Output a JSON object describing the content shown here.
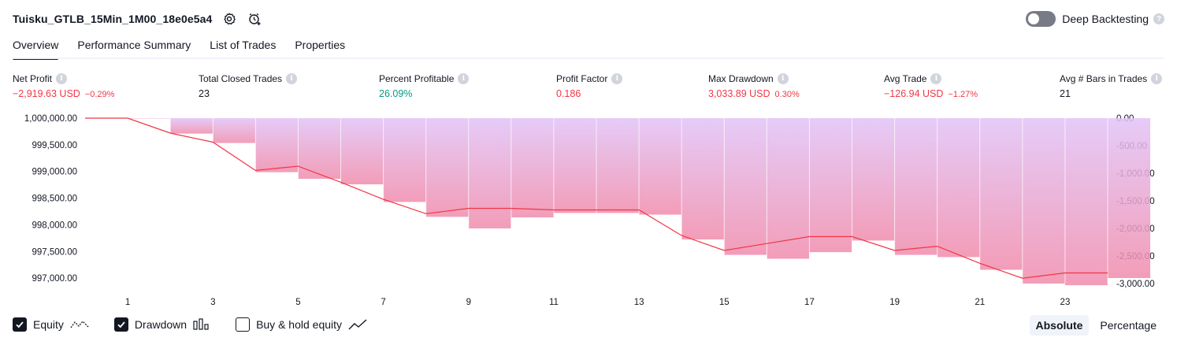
{
  "strategy": {
    "title": "Tuisku_GTLB_15Min_1M00_18e0e5a4"
  },
  "deep_backtesting": {
    "label": "Deep Backtesting",
    "enabled": false
  },
  "tabs": [
    {
      "label": "Overview",
      "active": true
    },
    {
      "label": "Performance Summary",
      "active": false
    },
    {
      "label": "List of Trades",
      "active": false
    },
    {
      "label": "Properties",
      "active": false
    }
  ],
  "metrics": {
    "net_profit": {
      "label": "Net Profit",
      "value": "−2,919.63 USD",
      "sub": "−0.29%"
    },
    "total_closed_trades": {
      "label": "Total Closed Trades",
      "value": "23"
    },
    "percent_profitable": {
      "label": "Percent Profitable",
      "value": "26.09%"
    },
    "profit_factor": {
      "label": "Profit Factor",
      "value": "0.186"
    },
    "max_drawdown": {
      "label": "Max Drawdown",
      "value": "3,033.89 USD",
      "sub": "0.30%"
    },
    "avg_trade": {
      "label": "Avg Trade",
      "value": "−126.94 USD",
      "sub": "−1.27%"
    },
    "avg_bars": {
      "label": "Avg # Bars in Trades",
      "value": "21"
    }
  },
  "legend": {
    "equity": {
      "label": "Equity",
      "checked": true
    },
    "drawdown": {
      "label": "Drawdown",
      "checked": true
    },
    "buy_hold": {
      "label": "Buy & hold equity",
      "checked": false
    }
  },
  "scale": {
    "absolute": "Absolute",
    "percentage": "Percentage"
  },
  "colors": {
    "equity_line": "#f23645",
    "drawdown_top": "#e1c2f7",
    "drawdown_bottom": "#f08cac",
    "negative": "#f23645",
    "positive": "#089981"
  },
  "chart_data": {
    "type": "area",
    "x_ticks": [
      "1",
      "3",
      "5",
      "7",
      "9",
      "11",
      "13",
      "15",
      "17",
      "19",
      "21",
      "23"
    ],
    "left_axis_ticks": [
      "1,000,000.00",
      "999,500.00",
      "999,000.00",
      "998,500.00",
      "998,000.00",
      "997,500.00",
      "997,000.00"
    ],
    "right_axis_ticks": [
      "0.00",
      "-500.00",
      "-1,000.00",
      "-1,500.00",
      "-2,000.00",
      "-2,500.00",
      "-3,000.00"
    ],
    "equity_ylim": [
      996900,
      1000000
    ],
    "drawdown_ylim": [
      -3000,
      0
    ],
    "series": [
      {
        "name": "Equity",
        "x": [
          0,
          1,
          2,
          3,
          4,
          5,
          6,
          7,
          8,
          9,
          10,
          11,
          12,
          13,
          14,
          15,
          16,
          17,
          18,
          19,
          20,
          21,
          22,
          23,
          24
        ],
        "values": [
          1000000,
          1000000,
          999720,
          999550,
          999020,
          999100,
          998800,
          998480,
          998210,
          998310,
          998310,
          998280,
          998280,
          998280,
          997800,
          997520,
          997650,
          997780,
          997780,
          997520,
          997600,
          997280,
          997000,
          997100,
          997100
        ]
      },
      {
        "name": "Drawdown",
        "x": [
          1,
          2,
          3,
          4,
          5,
          6,
          7,
          8,
          9,
          10,
          11,
          12,
          13,
          14,
          15,
          16,
          17,
          18,
          19,
          20,
          21,
          22,
          23,
          24
        ],
        "values": [
          0,
          -280,
          -450,
          -980,
          -1100,
          -1200,
          -1520,
          -1790,
          -2000,
          -1800,
          -1720,
          -1720,
          -1750,
          -2200,
          -2480,
          -2550,
          -2430,
          -2220,
          -2480,
          -2520,
          -2750,
          -3000,
          -3030,
          -2900
        ]
      }
    ]
  }
}
